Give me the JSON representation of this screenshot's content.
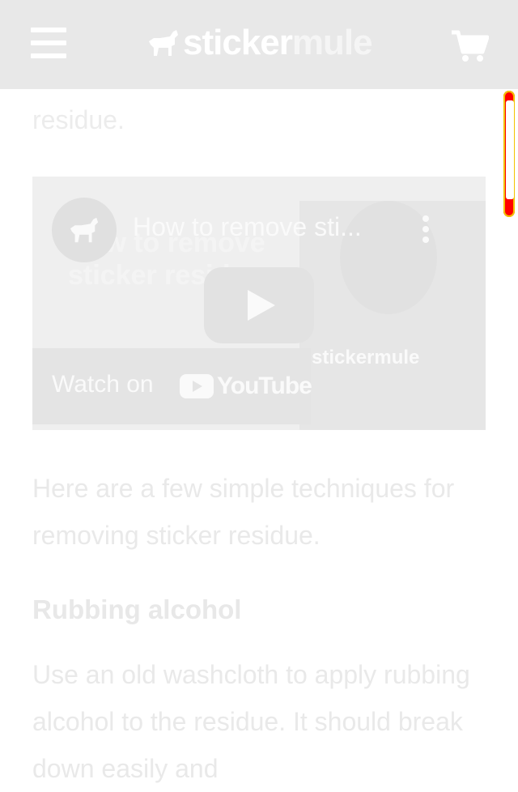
{
  "header": {
    "logo_sticker": "sticker",
    "logo_mule": "mule",
    "menu_icon": "hamburger-menu-icon",
    "cart_icon": "shopping-cart-icon"
  },
  "article": {
    "partial_top_text": "residue.",
    "intro": "Here are a few simple techniques for removing sticker residue.",
    "section_heading": "Rubbing alcohol",
    "section_text": "Use an old washcloth to apply rubbing alcohol to the residue. It should break down easily and"
  },
  "video": {
    "title": "How to remove sti...",
    "thumbnail_text": "How to remove\nsticker residue",
    "shirt_logo": "stickermule",
    "watch_label": "Watch on",
    "youtube_word": "YouTube",
    "avatar_icon": "horse-icon",
    "more_icon": "more-vertical-icon",
    "play_icon": "play-icon"
  },
  "colors": {
    "header_bg": "#e8e8e8",
    "scrollbar": "#ff0000"
  }
}
